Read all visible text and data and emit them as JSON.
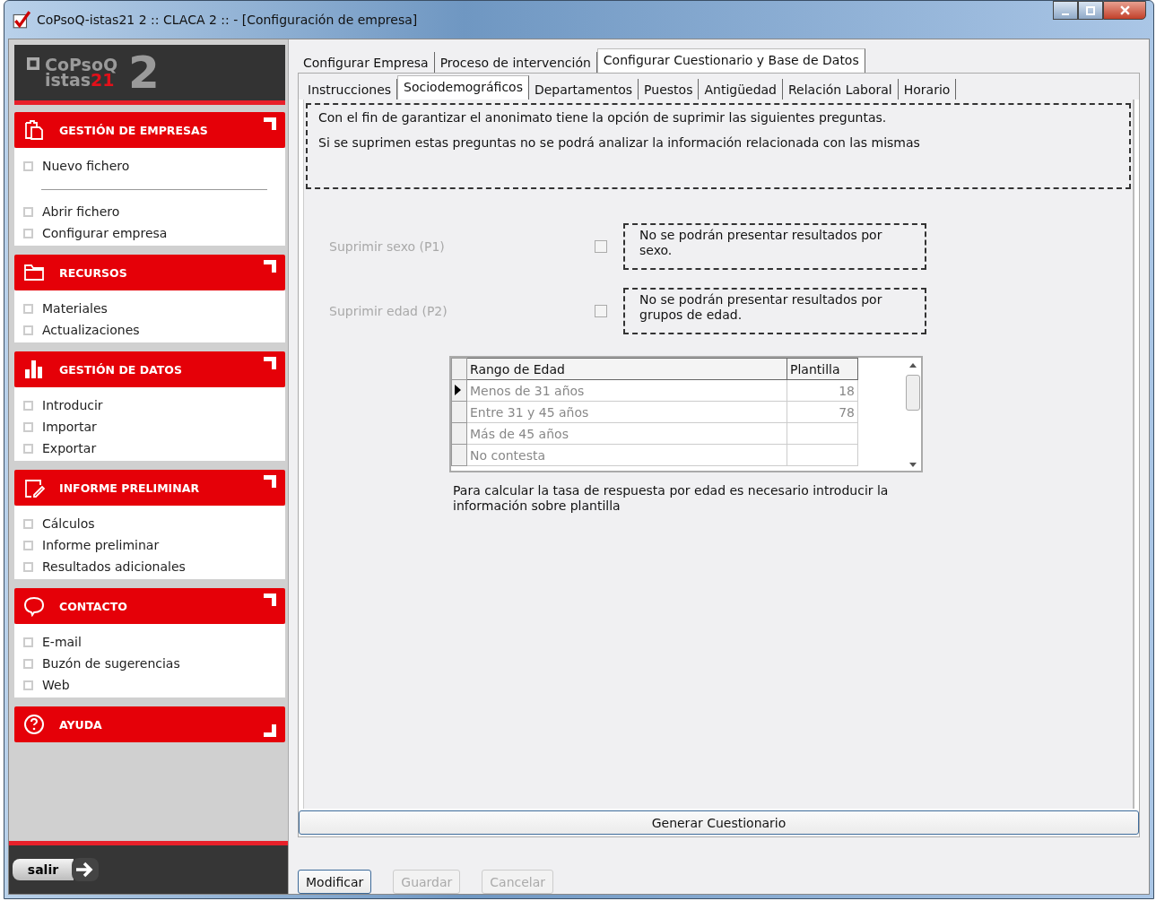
{
  "window": {
    "title": "CoPsoQ-istas21 2 :: CLACA 2 :: - [Configuración de empresa]"
  },
  "logo": {
    "line1": "CoPsoQ",
    "line2": "istas",
    "line2_accent": "21",
    "version": "2"
  },
  "sidebar": {
    "sections": [
      {
        "title": "GESTIÓN DE EMPRESAS",
        "kind": "clipboard",
        "expanded": true,
        "items": [
          {
            "kind": "item",
            "label": "Nuevo fichero"
          },
          {
            "kind": "divider"
          },
          {
            "kind": "item",
            "label": "Abrir fichero"
          },
          {
            "kind": "item",
            "label": "Configurar empresa"
          }
        ]
      },
      {
        "title": "RECURSOS",
        "kind": "folder",
        "expanded": true,
        "items": [
          {
            "kind": "item",
            "label": "Materiales"
          },
          {
            "kind": "item",
            "label": "Actualizaciones"
          }
        ]
      },
      {
        "title": "GESTIÓN DE DATOS",
        "kind": "bars",
        "expanded": true,
        "items": [
          {
            "kind": "item",
            "label": "Introducir"
          },
          {
            "kind": "item",
            "label": "Importar"
          },
          {
            "kind": "item",
            "label": "Exportar"
          }
        ]
      },
      {
        "title": "INFORME PRELIMINAR",
        "kind": "note",
        "expanded": true,
        "items": [
          {
            "kind": "item",
            "label": "Cálculos"
          },
          {
            "kind": "item",
            "label": "Informe preliminar"
          },
          {
            "kind": "item",
            "label": "Resultados adicionales"
          }
        ]
      },
      {
        "title": "CONTACTO",
        "kind": "chat",
        "expanded": true,
        "items": [
          {
            "kind": "item",
            "label": "E-mail"
          },
          {
            "kind": "item",
            "label": "Buzón de sugerencias"
          },
          {
            "kind": "item",
            "label": "Web"
          }
        ]
      },
      {
        "title": "AYUDA",
        "kind": "help",
        "expanded": false
      }
    ],
    "exit_button": "salir"
  },
  "tabs": [
    {
      "label": "Configurar Empresa",
      "selected": false
    },
    {
      "label": "Proceso de intervención",
      "selected": false
    },
    {
      "label": "Configurar Cuestionario y Base de Datos",
      "selected": true
    }
  ],
  "subtabs": [
    {
      "label": "Instrucciones",
      "selected": false
    },
    {
      "label": "Sociodemográficos",
      "selected": true
    },
    {
      "label": "Departamentos",
      "selected": false
    },
    {
      "label": "Puestos",
      "selected": false
    },
    {
      "label": "Antigüedad",
      "selected": false
    },
    {
      "label": "Relación Laboral",
      "selected": false
    },
    {
      "label": "Horario",
      "selected": false
    }
  ],
  "intro": [
    "Con el fin de garantizar el anonimato tiene la opción de suprimir las siguientes preguntas.",
    "Si se suprimen estas preguntas no se podrá analizar la información relacionada con las  mismas"
  ],
  "options": [
    {
      "label": "Suprimir sexo (P1)",
      "checked": false,
      "disabled": true,
      "note": "No se podrán presentar resultados por sexo."
    },
    {
      "label": "Suprimir edad (P2)",
      "checked": false,
      "disabled": true,
      "note": "No se podrán presentar resultados por grupos de edad."
    }
  ],
  "table": {
    "columns": [
      "Rango de Edad",
      "Plantilla"
    ],
    "disabled": true,
    "rows": [
      {
        "cells": [
          "Menos de 31 años",
          "18"
        ],
        "selected": true
      },
      {
        "cells": [
          "Entre 31 y 45 años",
          "78"
        ],
        "selected": false
      },
      {
        "cells": [
          "Más de 45 años",
          ""
        ],
        "selected": false
      },
      {
        "cells": [
          "No contesta",
          ""
        ],
        "selected": false
      }
    ]
  },
  "table_note": "Para calcular la tasa de respuesta por edad es necesario introducir la información sobre plantilla",
  "generate_button": "Generar Cuestionario",
  "buttons": [
    {
      "label": "Modificar",
      "disabled": false
    },
    {
      "label": "Guardar",
      "disabled": true
    },
    {
      "label": "Cancelar",
      "disabled": true
    }
  ]
}
